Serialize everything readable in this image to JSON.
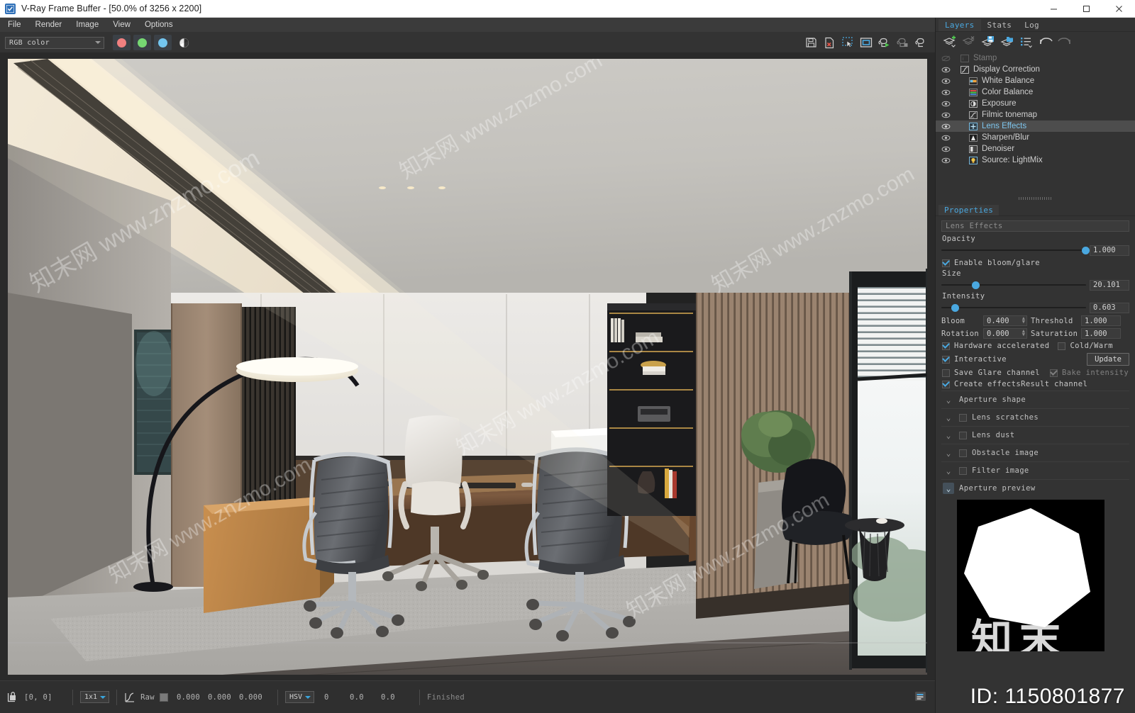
{
  "window": {
    "title": "V-Ray Frame Buffer - [50.0% of 3256 x 2200]",
    "minimize": "─",
    "maximize": "□",
    "close": "✕"
  },
  "menu": {
    "items": [
      "File",
      "Render",
      "Image",
      "View",
      "Options"
    ]
  },
  "toolbar": {
    "channel_select": "RGB color",
    "channel_buttons": [
      "red-channel",
      "green-channel",
      "blue-channel"
    ],
    "alpha_icon": "alpha-channel-icon",
    "icons": [
      "save-image-icon",
      "clear-image-icon",
      "region-render-icon",
      "show-vfb-window-icon",
      "start-render-icon",
      "stop-render-icon",
      "render-last-icon"
    ]
  },
  "dock": {
    "tabs": [
      {
        "label": "Layers",
        "active": true
      },
      {
        "label": "Stats",
        "active": false
      },
      {
        "label": "Log",
        "active": false
      }
    ],
    "layer_toolbar": [
      "add-layer-icon",
      "delete-layer-icon",
      "save-layers-icon",
      "load-layers-icon",
      "layer-presets-icon",
      "undo-icon",
      "redo-icon"
    ],
    "layers": [
      {
        "name": "Stamp",
        "visible": false,
        "enabled": false,
        "indent": 0,
        "icon": "stamp-icon",
        "selected": false
      },
      {
        "name": "Display Correction",
        "visible": true,
        "enabled": true,
        "indent": 0,
        "icon": "curve-icon",
        "selected": false
      },
      {
        "name": "White Balance",
        "visible": true,
        "enabled": true,
        "indent": 1,
        "icon": "white-balance-icon",
        "selected": false
      },
      {
        "name": "Color Balance",
        "visible": true,
        "enabled": true,
        "indent": 1,
        "icon": "color-balance-icon",
        "selected": false
      },
      {
        "name": "Exposure",
        "visible": true,
        "enabled": true,
        "indent": 1,
        "icon": "exposure-icon",
        "selected": false
      },
      {
        "name": "Filmic tonemap",
        "visible": true,
        "enabled": true,
        "indent": 1,
        "icon": "filmic-tonemap-icon",
        "selected": false
      },
      {
        "name": "Lens Effects",
        "visible": true,
        "enabled": true,
        "indent": 1,
        "icon": "lens-effects-icon",
        "selected": true
      },
      {
        "name": "Sharpen/Blur",
        "visible": true,
        "enabled": true,
        "indent": 1,
        "icon": "sharpen-blur-icon",
        "selected": false
      },
      {
        "name": "Denoiser",
        "visible": true,
        "enabled": true,
        "indent": 1,
        "icon": "denoiser-icon",
        "selected": false
      },
      {
        "name": "Source: LightMix",
        "visible": true,
        "enabled": true,
        "indent": 1,
        "icon": "lightmix-icon",
        "selected": false
      }
    ]
  },
  "properties": {
    "tab_label": "Properties",
    "layer_name": "Lens Effects",
    "opacity_label": "Opacity",
    "opacity_value": "1.000",
    "opacity_pct": 97,
    "enable_bloom_label": "Enable bloom/glare",
    "enable_bloom_checked": true,
    "size_label": "Size",
    "size_value": "20.101",
    "size_pct": 21,
    "intensity_label": "Intensity",
    "intensity_value": "0.603",
    "intensity_pct": 7,
    "bloom_label": "Bloom",
    "bloom_value": "0.400",
    "threshold_label": "Threshold",
    "threshold_value": "1.000",
    "rotation_label": "Rotation",
    "rotation_value": "0.000",
    "saturation_label": "Saturation",
    "saturation_value": "1.000",
    "hardware_accelerated_label": "Hardware accelerated",
    "hardware_accelerated_checked": true,
    "cold_warm_label": "Cold/Warm",
    "cold_warm_checked": false,
    "interactive_label": "Interactive",
    "interactive_checked": true,
    "update_button": "Update",
    "save_glare_label": "Save Glare channel",
    "save_glare_checked": false,
    "bake_intensity_label": "Bake intensity",
    "bake_intensity_checked": true,
    "bake_intensity_disabled": true,
    "create_effects_label": "Create effectsResult channel",
    "create_effects_checked": true,
    "sections": [
      {
        "label": "Aperture shape",
        "has_checkbox": false,
        "checked": false,
        "expanded": false
      },
      {
        "label": "Lens scratches",
        "has_checkbox": true,
        "checked": false,
        "expanded": false
      },
      {
        "label": "Lens dust",
        "has_checkbox": true,
        "checked": false,
        "expanded": false
      },
      {
        "label": "Obstacle image",
        "has_checkbox": true,
        "checked": false,
        "expanded": false
      },
      {
        "label": "Filter image",
        "has_checkbox": true,
        "checked": false,
        "expanded": false
      },
      {
        "label": "Aperture preview",
        "has_checkbox": false,
        "checked": false,
        "expanded": true
      }
    ]
  },
  "statusbar": {
    "pixel_lock_icon": "pixel-lock-icon",
    "coords": "[0,  0]",
    "sample_size": "1x1",
    "curve_icon": "color-curve-icon",
    "raw_label": "Raw",
    "color_swatch": "#7b7b7b",
    "raw_values": [
      "0.000",
      "0.000",
      "0.000"
    ],
    "color_mode": "HSV",
    "hsv_values": [
      "0",
      "0.0",
      "0.0"
    ],
    "status": "Finished",
    "history_icon": "render-history-icon"
  },
  "accent": {
    "blue": "#4aa8e0",
    "tab_blue": "#4aa8e0",
    "green": "#76d872",
    "red": "#f08080",
    "light_blue": "#73c5ee"
  },
  "watermarks": {
    "url": "知末网 www.znzmo.com",
    "cn": "知末",
    "id": "ID: 1150801877"
  }
}
